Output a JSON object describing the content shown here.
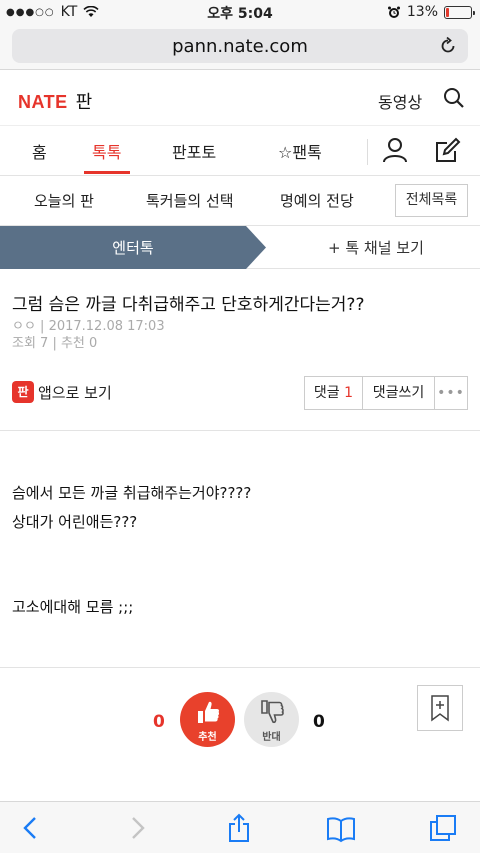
{
  "status": {
    "carrier": "KT",
    "time": "오후 5:04",
    "battery": "13%",
    "battery_level": 0.13
  },
  "browser": {
    "url": "pann.nate.com"
  },
  "header": {
    "logo": "NATE",
    "section": "판",
    "video": "동영상"
  },
  "nav": {
    "tabs": [
      "홈",
      "톡톡",
      "판포토",
      "☆팬톡"
    ],
    "active_index": 1
  },
  "subnav": {
    "items": [
      "오늘의 판",
      "톡커들의 선택",
      "명예의 전당"
    ],
    "all_list": "전체목록"
  },
  "banner": {
    "category": "엔터톡",
    "channel_link": "+ 톡 채널 보기"
  },
  "article": {
    "title": "그럼 슴은 까글 다취급해주고 단호하게간다는거??",
    "author_date": "ㅇㅇ  | 2017.12.08 17:03",
    "stats": "조회 7 | 추천 0",
    "app_view": "앱으로 보기",
    "app_icon_text": "판",
    "comments_label": "댓글",
    "comments_count": "1",
    "write_comment": "댓글쓰기",
    "more": "•••",
    "body": [
      "슴에서 모든 까글 취급해주는거야????",
      "상대가 어린애든???",
      "고소에대해 모름 ;;;"
    ]
  },
  "votes": {
    "up_count": "0",
    "up_label": "추천",
    "down_count": "0",
    "down_label": "반대"
  },
  "colors": {
    "accent": "#e6342b",
    "banner_bg": "#5a7087"
  }
}
